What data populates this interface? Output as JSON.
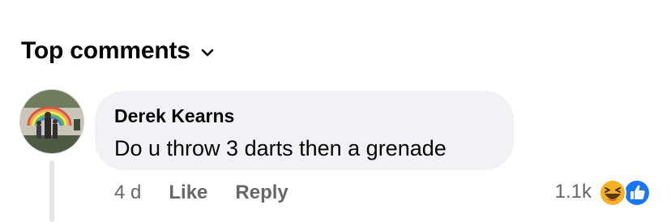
{
  "header": {
    "title": "Top comments"
  },
  "comment": {
    "author": "Derek Kearns",
    "text": "Do u throw 3 darts then a grenade",
    "time": "4 d",
    "like_label": "Like",
    "reply_label": "Reply",
    "reaction_count": "1.1k",
    "reaction_icons": [
      "haha-icon",
      "like-icon"
    ]
  },
  "colors": {
    "bubble": "#f0f2f5",
    "secondary_text": "#65676b",
    "like_blue": "#1877f2",
    "haha_yellow": "#f7b125"
  }
}
